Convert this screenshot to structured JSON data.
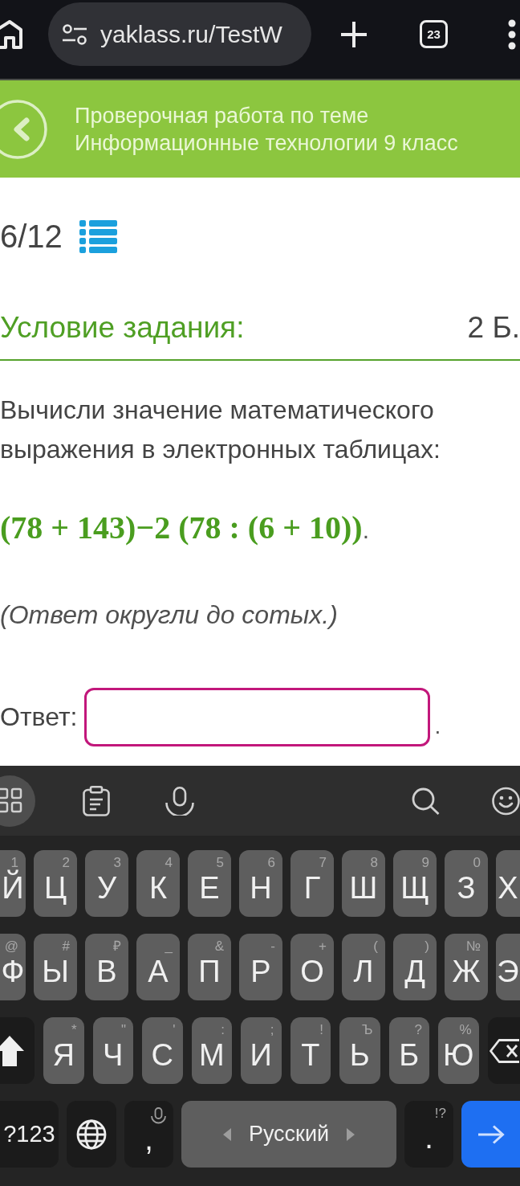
{
  "browser": {
    "url": "yaklass.ru/TestW",
    "tab_count": "23"
  },
  "header": {
    "title": "Проверочная работа по теме Информационные технологии 9 класс"
  },
  "progress": {
    "counter": "6/12"
  },
  "task": {
    "heading": "Условие задания:",
    "points": "2 Б.",
    "text": "Вычисли значение математического выражения в электронных таблицах:",
    "expression": "(78 + 143)−2 (78 : (6 + 10))",
    "expression_end": ".",
    "note": "(Ответ округли до сотых.)",
    "answer_label": "Ответ:",
    "answer_suffix": "."
  },
  "keyboard": {
    "rows": [
      {
        "keys": [
          {
            "kind": "letter",
            "label": "Й",
            "hint": "1"
          },
          {
            "kind": "letter",
            "label": "Ц",
            "hint": "2"
          },
          {
            "kind": "letter",
            "label": "У",
            "hint": "3"
          },
          {
            "kind": "letter",
            "label": "К",
            "hint": "4"
          },
          {
            "kind": "letter",
            "label": "Е",
            "hint": "5"
          },
          {
            "kind": "letter",
            "label": "Н",
            "hint": "6"
          },
          {
            "kind": "letter",
            "label": "Г",
            "hint": "7"
          },
          {
            "kind": "letter",
            "label": "Ш",
            "hint": "8"
          },
          {
            "kind": "letter",
            "label": "Щ",
            "hint": "9"
          },
          {
            "kind": "letter",
            "label": "З",
            "hint": "0"
          },
          {
            "kind": "letter",
            "label": "Х"
          }
        ]
      },
      {
        "keys": [
          {
            "kind": "letter",
            "label": "Ф",
            "hint": "@"
          },
          {
            "kind": "letter",
            "label": "Ы",
            "hint": "#"
          },
          {
            "kind": "letter",
            "label": "В",
            "hint": "₽"
          },
          {
            "kind": "letter",
            "label": "А",
            "hint": "_"
          },
          {
            "kind": "letter",
            "label": "П",
            "hint": "&"
          },
          {
            "kind": "letter",
            "label": "Р",
            "hint": "-"
          },
          {
            "kind": "letter",
            "label": "О",
            "hint": "+"
          },
          {
            "kind": "letter",
            "label": "Л",
            "hint": "("
          },
          {
            "kind": "letter",
            "label": "Д",
            "hint": ")"
          },
          {
            "kind": "letter",
            "label": "Ж",
            "hint": "№"
          },
          {
            "kind": "letter",
            "label": "Э"
          }
        ]
      },
      {
        "keys": [
          {
            "kind": "shift"
          },
          {
            "kind": "letter",
            "label": "Я",
            "hint": "*"
          },
          {
            "kind": "letter",
            "label": "Ч",
            "hint": "\""
          },
          {
            "kind": "letter",
            "label": "С",
            "hint": "'"
          },
          {
            "kind": "letter",
            "label": "М",
            "hint": ":"
          },
          {
            "kind": "letter",
            "label": "И",
            "hint": ";"
          },
          {
            "kind": "letter",
            "label": "Т",
            "hint": "!"
          },
          {
            "kind": "letter",
            "label": "Ь",
            "hint": "Ъ"
          },
          {
            "kind": "letter",
            "label": "Б",
            "hint": "?"
          },
          {
            "kind": "letter",
            "label": "Ю",
            "hint": "%"
          },
          {
            "kind": "backspace"
          }
        ]
      },
      {
        "keys": [
          {
            "kind": "mode",
            "label": "?123"
          },
          {
            "kind": "globe"
          },
          {
            "kind": "comma",
            "label": ","
          },
          {
            "kind": "space",
            "label": "Русский"
          },
          {
            "kind": "period",
            "label": ".",
            "hint": "!?"
          },
          {
            "kind": "enter"
          }
        ]
      }
    ]
  }
}
